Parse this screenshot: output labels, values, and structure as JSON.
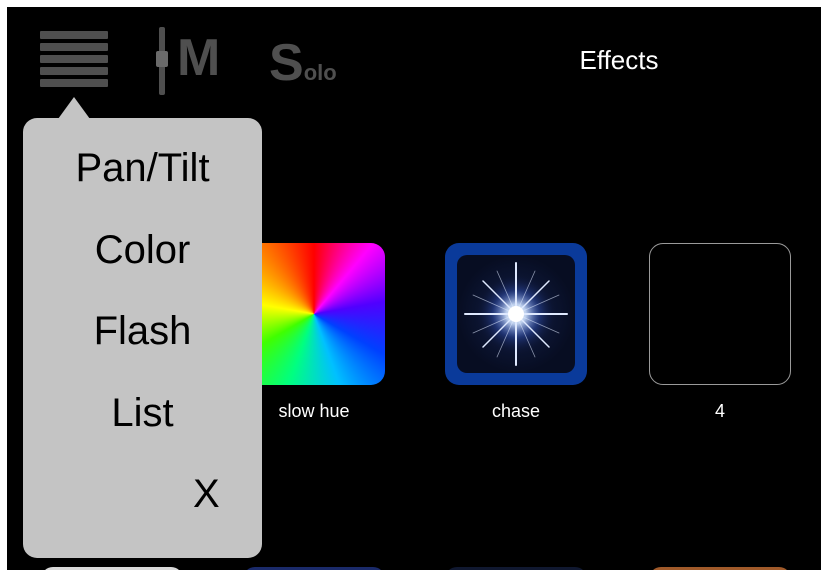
{
  "toolbar": {
    "menu_icon": "hamburger-icon",
    "master_letter": "M",
    "solo_first": "S",
    "solo_rest": "olo",
    "title": "Effects"
  },
  "popover": {
    "items": [
      "Pan/Tilt",
      "Color",
      "Flash",
      "List"
    ],
    "close_label": "X"
  },
  "effects": [
    {
      "label": "slow hue",
      "icon": "color-wheel"
    },
    {
      "label": "chase",
      "icon": "starburst-icon",
      "selected": true
    },
    {
      "label": "4",
      "icon": "empty-slot"
    }
  ],
  "colors": {
    "background": "#000000",
    "popover": "#c4c4c4",
    "toolbar_icon": "#4f4f4f",
    "selected_border": "#0a3a9a"
  }
}
